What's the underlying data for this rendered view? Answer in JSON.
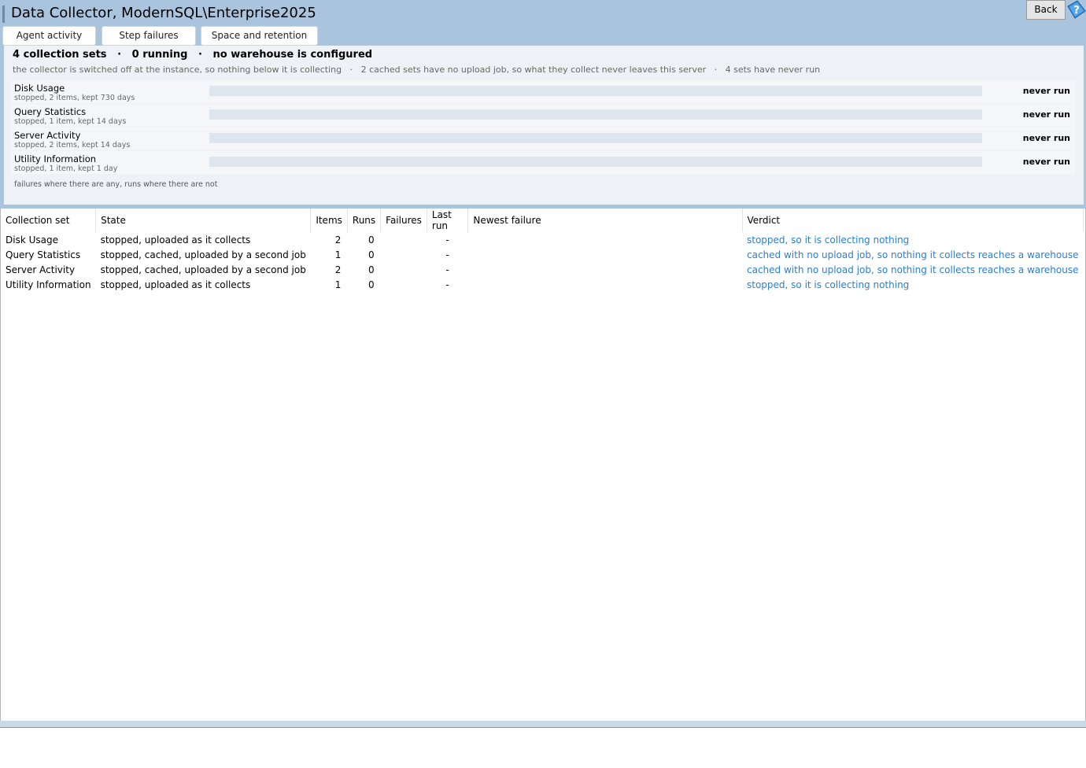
{
  "app": {
    "title": "Data Collector, ModernSQL\\Enterprise2025",
    "back_label": "Back"
  },
  "tabs": [
    {
      "label": "Agent activity"
    },
    {
      "label": "Step failures"
    },
    {
      "label": "Space and retention"
    }
  ],
  "summary": {
    "headline": "4 collection sets   ·   0 running   ·   no warehouse is configured",
    "subline": "the collector is switched off at the instance, so nothing below it is collecting   ·   2 cached sets have no upload job, so what they collect never leaves this server   ·   4 sets have never run",
    "rows": [
      {
        "name": "Disk Usage",
        "meta": "stopped, 2 items, kept 730 days",
        "status": "never run"
      },
      {
        "name": "Query Statistics",
        "meta": "stopped, 1 item, kept 14 days",
        "status": "never run"
      },
      {
        "name": "Server Activity",
        "meta": "stopped, 2 items, kept 14 days",
        "status": "never run"
      },
      {
        "name": "Utility Information",
        "meta": "stopped, 1 item, kept 1 day",
        "status": "never run"
      }
    ],
    "footnote": "failures where there are any, runs where there are not"
  },
  "grid": {
    "columns": [
      "Collection set",
      "State",
      "Items",
      "Runs",
      "Failures",
      "Last run",
      "Newest failure",
      "Verdict"
    ],
    "rows": [
      {
        "set": "Disk Usage",
        "state": "stopped, uploaded as it collects",
        "items": "2",
        "runs": "0",
        "failures": "",
        "last_run": "-",
        "newest_failure": "",
        "verdict": "stopped, so it is collecting nothing"
      },
      {
        "set": "Query Statistics",
        "state": "stopped, cached, uploaded by a second job",
        "items": "1",
        "runs": "0",
        "failures": "",
        "last_run": "-",
        "newest_failure": "",
        "verdict": "cached with no upload job, so nothing it collects reaches a warehouse"
      },
      {
        "set": "Server Activity",
        "state": "stopped, cached, uploaded by a second job",
        "items": "2",
        "runs": "0",
        "failures": "",
        "last_run": "-",
        "newest_failure": "",
        "verdict": "cached with no upload job, so nothing it collects reaches a warehouse"
      },
      {
        "set": "Utility Information",
        "state": "stopped, uploaded as it collects",
        "items": "1",
        "runs": "0",
        "failures": "",
        "last_run": "-",
        "newest_failure": "",
        "verdict": "stopped, so it is collecting nothing"
      }
    ]
  },
  "icons": {
    "help": "help-icon"
  },
  "colors": {
    "header_bg": "#a9c4dc",
    "verdict_link": "#2a7fd0"
  }
}
